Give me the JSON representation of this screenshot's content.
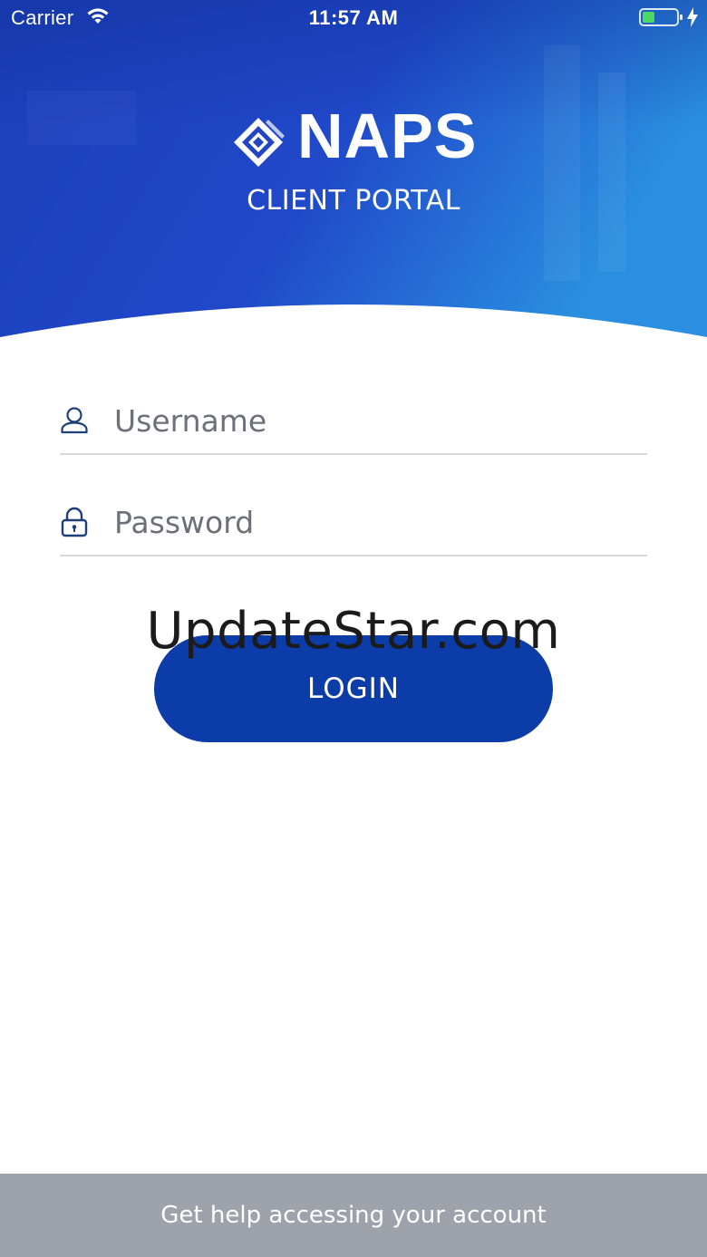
{
  "status_bar": {
    "carrier": "Carrier",
    "time": "11:57 AM",
    "wifi_icon": "wifi-icon",
    "battery_icon": "battery-icon",
    "charging_icon": "charging-bolt-icon",
    "battery_level": 0.35
  },
  "brand": {
    "logo_icon": "naps-diamond-logo-icon",
    "name": "NAPS",
    "subtitle": "CLIENT PORTAL",
    "header_color": "#1e45c8",
    "accent_color": "#0b3ca8"
  },
  "form": {
    "username": {
      "icon": "user-icon",
      "placeholder": "Username",
      "value": ""
    },
    "password": {
      "icon": "lock-icon",
      "placeholder": "Password",
      "value": ""
    },
    "login_label": "LOGIN"
  },
  "watermark": "UpdateStar.com",
  "footer": {
    "help_label": "Get help accessing your account",
    "background": "#9ea3ab"
  }
}
